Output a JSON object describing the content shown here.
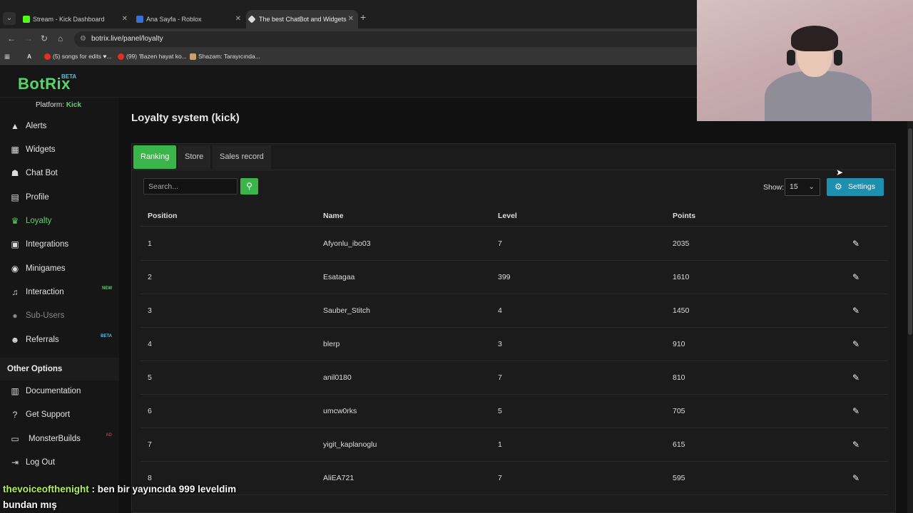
{
  "browser": {
    "tabs": [
      {
        "title": "Stream - Kick Dashboard",
        "color": "#53fc18"
      },
      {
        "title": "Ana Sayfa - Roblox",
        "color": "#3b6fd8"
      },
      {
        "title": "The best ChatBot and Widgets",
        "color": "#dddddd"
      }
    ],
    "url": "botrix.live/panel/loyalty",
    "bookmarks": [
      {
        "label": "(5) songs for edits ♥...",
        "color": "#e52d27"
      },
      {
        "label": "(99) 'Bazen hayat ko...",
        "color": "#e52d27"
      },
      {
        "label": "Shazam: Tarayıcında...",
        "color": "#c9a26b"
      }
    ]
  },
  "app": {
    "logo": "BotRix",
    "logo_badge": "BETA",
    "platform_label": "Platform:",
    "platform_value": "Kick"
  },
  "sidebar": {
    "items": [
      {
        "label": "Alerts",
        "icon": "warning-icon"
      },
      {
        "label": "Widgets",
        "icon": "grid-icon"
      },
      {
        "label": "Chat Bot",
        "icon": "robot-icon"
      },
      {
        "label": "Profile",
        "icon": "id-card-icon"
      },
      {
        "label": "Loyalty",
        "icon": "trophy-icon"
      },
      {
        "label": "Integrations",
        "icon": "puzzle-icon"
      },
      {
        "label": "Minigames",
        "icon": "gamepad-icon"
      },
      {
        "label": "Interaction",
        "icon": "music-icon",
        "badge": "NEW"
      },
      {
        "label": "Sub-Users",
        "icon": "users-icon"
      },
      {
        "label": "Referrals",
        "icon": "user-plus-icon",
        "badge": "BETA"
      }
    ],
    "other_title": "Other Options",
    "other_items": [
      {
        "label": "Documentation",
        "icon": "book-icon"
      },
      {
        "label": "Get Support",
        "icon": "question-icon"
      },
      {
        "label": "MonsterBuilds",
        "icon": "monitor-icon",
        "badge": "AD"
      },
      {
        "label": "Log Out",
        "icon": "logout-icon"
      }
    ]
  },
  "main": {
    "title": "Loyalty system (kick)",
    "tabs": [
      "Ranking",
      "Store",
      "Sales record"
    ],
    "search_placeholder": "Search...",
    "show_label": "Show:",
    "show_value": "15",
    "settings_label": "Settings",
    "columns": [
      "Position",
      "Name",
      "Level",
      "Points"
    ],
    "rows": [
      {
        "position": "1",
        "name": "Afyonlu_ibo03",
        "level": "7",
        "points": "2035"
      },
      {
        "position": "2",
        "name": "Esatagaa",
        "level": "399",
        "points": "1610"
      },
      {
        "position": "3",
        "name": "Sauber_Stitch",
        "level": "4",
        "points": "1450"
      },
      {
        "position": "4",
        "name": "blerp",
        "level": "3",
        "points": "910"
      },
      {
        "position": "5",
        "name": "anil0180",
        "level": "7",
        "points": "810"
      },
      {
        "position": "6",
        "name": "umcw0rks",
        "level": "5",
        "points": "705"
      },
      {
        "position": "7",
        "name": "yigit_kaplanoglu",
        "level": "1",
        "points": "615"
      },
      {
        "position": "8",
        "name": "AliEA721",
        "level": "7",
        "points": "595"
      }
    ]
  },
  "overlay": {
    "chat_user": "thevoiceofthenight",
    "chat_message_line1": ": ben bir yayıncıda 999 leveldim",
    "chat_message_line2": "bundan mış"
  }
}
